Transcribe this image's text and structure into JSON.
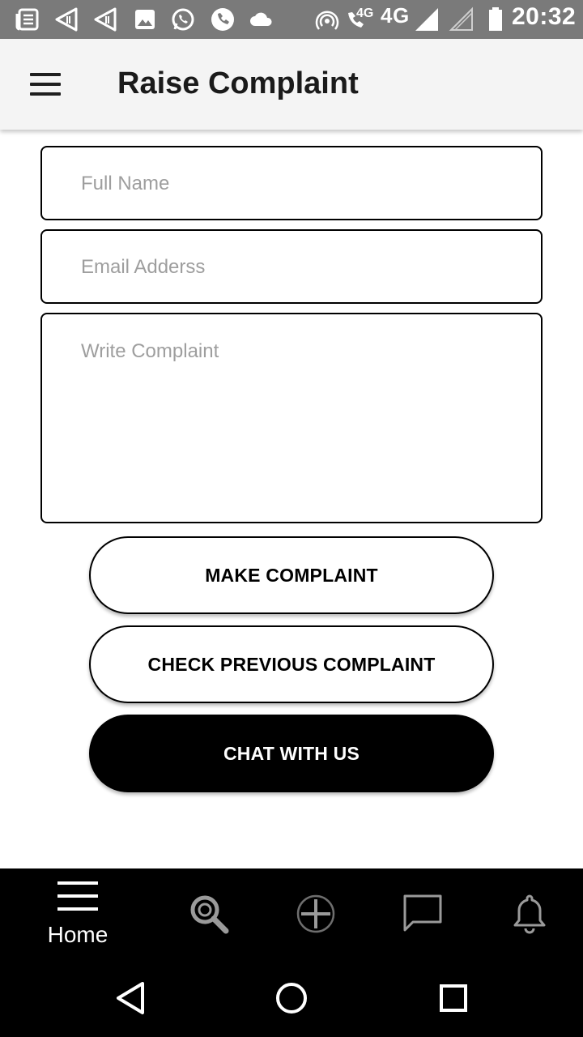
{
  "status_bar": {
    "time": "20:32",
    "network_label": "4G",
    "call_network_label": "4G",
    "icons": [
      "news-icon",
      "signal-app-icon",
      "signal-app-icon",
      "image-icon",
      "whatsapp-icon",
      "phone-icon",
      "cloud-icon",
      "hotspot-icon",
      "volte-call-icon",
      "cell-signal-icon",
      "cell-signal-empty-icon",
      "battery-icon"
    ]
  },
  "app_bar": {
    "title": "Raise Complaint",
    "menu_icon": "hamburger-icon"
  },
  "form": {
    "full_name": {
      "placeholder": "Full Name",
      "value": ""
    },
    "email": {
      "placeholder": "Email Adderss",
      "value": ""
    },
    "complaint": {
      "placeholder": "Write Complaint",
      "value": ""
    }
  },
  "buttons": {
    "make_complaint": "MAKE COMPLAINT",
    "check_previous": "CHECK PREVIOUS COMPLAINT",
    "chat": "CHAT WITH US"
  },
  "bottom_nav": {
    "items": [
      {
        "label": "Home",
        "icon": "menu-lines-icon",
        "active": true
      },
      {
        "label": "",
        "icon": "search-icon"
      },
      {
        "label": "",
        "icon": "add-circle-icon"
      },
      {
        "label": "",
        "icon": "chat-bubble-icon"
      },
      {
        "label": "",
        "icon": "bell-icon"
      }
    ]
  },
  "system_nav": {
    "icons": [
      "back-icon",
      "home-circle-icon",
      "recents-icon"
    ]
  },
  "colors": {
    "status_bar": "#7a7a7a",
    "app_bar": "#f4f4f4",
    "primary_dark": "#000000",
    "placeholder": "#9e9e9e"
  }
}
